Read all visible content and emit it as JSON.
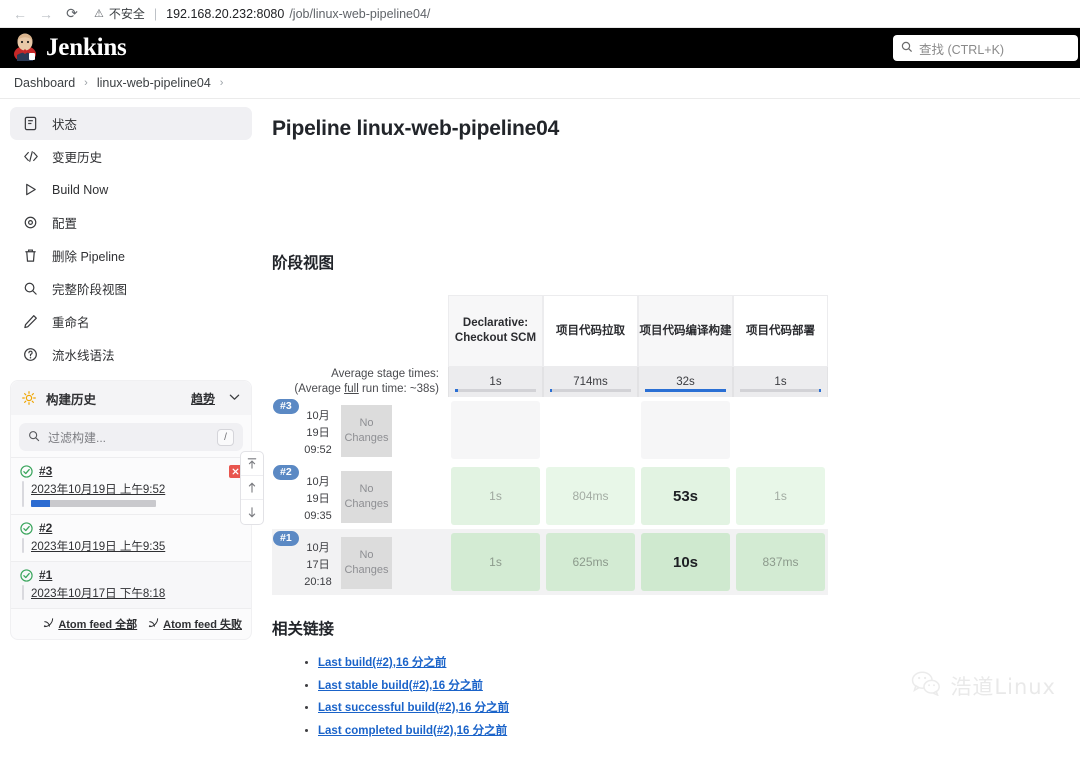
{
  "browser": {
    "back_icon": "←",
    "forward_icon": "→",
    "reload_icon": "⟳",
    "warning_icon": "⚠",
    "security_label": "不安全",
    "url_host": "192.168.20.232:8080",
    "url_path": "/job/linux-web-pipeline04/"
  },
  "header": {
    "brand": "Jenkins",
    "search_icon": "search-icon",
    "search_placeholder": "查找 (CTRL+K)"
  },
  "breadcrumb": {
    "items": [
      "Dashboard",
      "linux-web-pipeline04"
    ],
    "separator": "›"
  },
  "sidebar": {
    "items": [
      {
        "label": "状态",
        "icon": "document-status-icon",
        "active": true
      },
      {
        "label": "变更历史",
        "icon": "code-brackets-icon",
        "active": false
      },
      {
        "label": "Build Now",
        "icon": "play-triangle-icon",
        "active": false
      },
      {
        "label": "配置",
        "icon": "gear-icon",
        "active": false
      },
      {
        "label": "删除 Pipeline",
        "icon": "trash-icon",
        "active": false
      },
      {
        "label": "完整阶段视图",
        "icon": "search-icon",
        "active": false
      },
      {
        "label": "重命名",
        "icon": "pencil-icon",
        "active": false
      },
      {
        "label": "流水线语法",
        "icon": "question-circle-icon",
        "active": false
      }
    ]
  },
  "build_history": {
    "title": "构建历史",
    "sun_icon": "sun-icon",
    "trend_label": "趋势",
    "chevron_icon": "chevron-down-icon",
    "filter_placeholder": "过滤构建...",
    "filter_shortcut": "/",
    "builds": [
      {
        "number": "#3",
        "date": "2023年10月19日 上午9:52",
        "status": "success",
        "has_stop": true,
        "progress": 15
      },
      {
        "number": "#2",
        "date": "2023年10月19日 上午9:35",
        "status": "success",
        "has_stop": false,
        "progress": null
      },
      {
        "number": "#1",
        "date": "2023年10月17日 下午8:18",
        "status": "success",
        "has_stop": false,
        "progress": null
      }
    ],
    "feeds": [
      {
        "label": "Atom feed 全部",
        "icon": "rss-icon"
      },
      {
        "label": "Atom feed 失败",
        "icon": "rss-icon"
      }
    ],
    "scroll_buttons": [
      {
        "name": "scroll-to-top",
        "glyph": "⤒"
      },
      {
        "name": "scroll-up",
        "glyph": "↑"
      },
      {
        "name": "scroll-down",
        "glyph": "↓"
      }
    ]
  },
  "main": {
    "page_title": "Pipeline linux-web-pipeline04",
    "stage_view_title": "阶段视图",
    "avg_label_line1": "Average stage times:",
    "avg_label_line2_a": "(Average ",
    "avg_label_line2_u": "full",
    "avg_label_line2_b": " run time: ~38s)",
    "related_links_title": "相关链接",
    "related_links": [
      "Last build(#2),16 分之前",
      "Last stable build(#2),16 分之前",
      "Last successful build(#2),16 分之前",
      "Last completed build(#2),16 分之前"
    ]
  },
  "stage_view": {
    "columns": [
      {
        "name": "Declarative: Checkout SCM",
        "average": "1s",
        "bar_pct": 4,
        "bar_align": "left"
      },
      {
        "name": "项目代码拉取",
        "average": "714ms",
        "bar_pct": 3,
        "bar_align": "left"
      },
      {
        "name": "项目代码编译构建",
        "average": "32s",
        "bar_pct": 100,
        "bar_align": "left"
      },
      {
        "name": "项目代码部署",
        "average": "1s",
        "bar_pct": 3,
        "bar_align": "right"
      }
    ],
    "runs": [
      {
        "badge": "#3",
        "date_month": "10月",
        "date_day": "19日",
        "time": "09:52",
        "changes": "No Changes",
        "row_shade": "white",
        "cells": [
          {
            "text": "",
            "style": "empty-tint"
          },
          {
            "text": "",
            "style": "empty-plain"
          },
          {
            "text": "",
            "style": "empty-tint"
          },
          {
            "text": "",
            "style": "empty-plain"
          }
        ]
      },
      {
        "badge": "#2",
        "date_month": "10月",
        "date_day": "19日",
        "time": "09:35",
        "changes": "No Changes",
        "row_shade": "white",
        "cells": [
          {
            "text": "1s",
            "style": "g-light"
          },
          {
            "text": "804ms",
            "style": "g-lighter"
          },
          {
            "text": "53s",
            "style": "g-light bold"
          },
          {
            "text": "1s",
            "style": "g-lighter"
          }
        ]
      },
      {
        "badge": "#1",
        "date_month": "10月",
        "date_day": "17日",
        "time": "20:18",
        "changes": "No Changes",
        "row_shade": "gray",
        "cells": [
          {
            "text": "1s",
            "style": "g-dark"
          },
          {
            "text": "625ms",
            "style": "g-dark"
          },
          {
            "text": "10s",
            "style": "g-darker bold"
          },
          {
            "text": "837ms",
            "style": "g-dark"
          }
        ]
      }
    ]
  },
  "watermark": {
    "text": "浩道Linux",
    "icon": "wechat-logo-icon"
  },
  "colors": {
    "header_bg": "#000000",
    "accent_blue": "#1a63c9",
    "badge_blue": "#5b89c4",
    "success_green": "#3aa55d",
    "stop_red": "#e8554e",
    "bar_blue": "#2a6fd4"
  }
}
